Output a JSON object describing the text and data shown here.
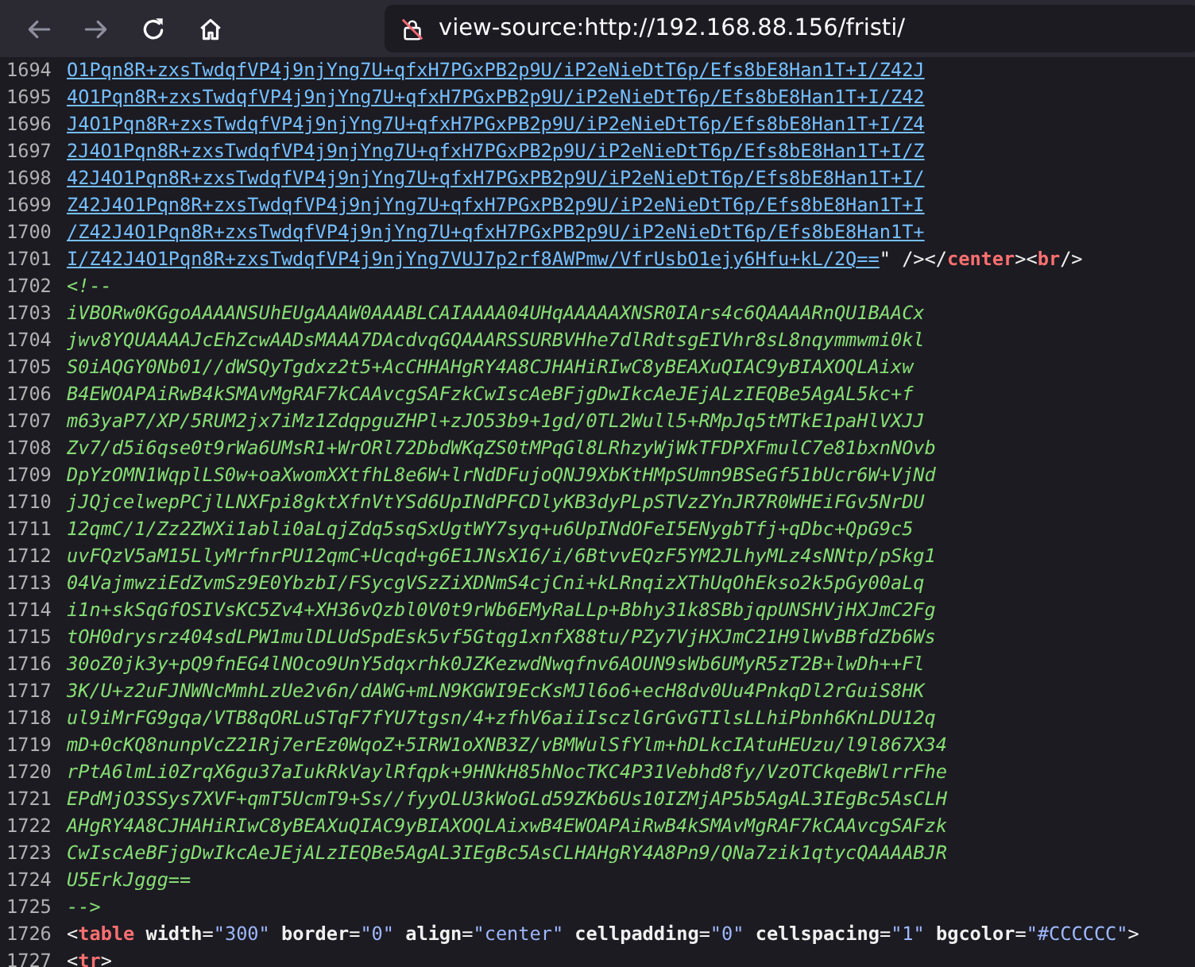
{
  "toolbar": {
    "nav": [
      {
        "kind": "back",
        "disabled": true
      },
      {
        "kind": "forward",
        "disabled": true
      },
      {
        "kind": "reload",
        "disabled": false
      },
      {
        "kind": "home",
        "disabled": false
      }
    ],
    "url": "view-source:http://192.168.88.156/fristi/"
  },
  "lines": [
    {
      "number": "1694",
      "tokens": [
        {
          "kind": "link",
          "text": "O1Pqn8R+zxsTwdqfVP4j9njYng7U+qfxH7PGxPB2p9U/iP2eNieDtT6p/Efs8bE8Han1T+I/Z42J"
        }
      ]
    },
    {
      "number": "1695",
      "tokens": [
        {
          "kind": "link",
          "text": "4O1Pqn8R+zxsTwdqfVP4j9njYng7U+qfxH7PGxPB2p9U/iP2eNieDtT6p/Efs8bE8Han1T+I/Z42"
        }
      ]
    },
    {
      "number": "1696",
      "tokens": [
        {
          "kind": "link",
          "text": "J4O1Pqn8R+zxsTwdqfVP4j9njYng7U+qfxH7PGxPB2p9U/iP2eNieDtT6p/Efs8bE8Han1T+I/Z4"
        }
      ]
    },
    {
      "number": "1697",
      "tokens": [
        {
          "kind": "link",
          "text": "2J4O1Pqn8R+zxsTwdqfVP4j9njYng7U+qfxH7PGxPB2p9U/iP2eNieDtT6p/Efs8bE8Han1T+I/Z"
        }
      ]
    },
    {
      "number": "1698",
      "tokens": [
        {
          "kind": "link",
          "text": "42J4O1Pqn8R+zxsTwdqfVP4j9njYng7U+qfxH7PGxPB2p9U/iP2eNieDtT6p/Efs8bE8Han1T+I/"
        }
      ]
    },
    {
      "number": "1699",
      "tokens": [
        {
          "kind": "link",
          "text": "Z42J4O1Pqn8R+zxsTwdqfVP4j9njYng7U+qfxH7PGxPB2p9U/iP2eNieDtT6p/Efs8bE8Han1T+I"
        }
      ]
    },
    {
      "number": "1700",
      "tokens": [
        {
          "kind": "link",
          "text": "/Z42J4O1Pqn8R+zxsTwdqfVP4j9njYng7U+qfxH7PGxPB2p9U/iP2eNieDtT6p/Efs8bE8Han1T+"
        }
      ]
    },
    {
      "number": "1701",
      "tokens": [
        {
          "kind": "link",
          "text": "I/Z42J4O1Pqn8R+zxsTwdqfVP4j9njYng7VUJ7p2rf8AWPmw/VfrUsbO1ejy6Hfu+kL/2Q=="
        },
        {
          "kind": "punct",
          "text": "\" /></"
        },
        {
          "kind": "tag",
          "text": "center"
        },
        {
          "kind": "punct",
          "text": "><"
        },
        {
          "kind": "tag",
          "text": "br"
        },
        {
          "kind": "punct",
          "text": "/>"
        }
      ]
    },
    {
      "number": "1702",
      "tokens": [
        {
          "kind": "comment",
          "text": "<!--"
        }
      ]
    },
    {
      "number": "1703",
      "tokens": [
        {
          "kind": "comment",
          "text": "iVBORw0KGgoAAAANSUhEUgAAAW0AAABLCAIAAAA04UHqAAAAAXNSR0IArs4c6QAAAARnQU1BAACx"
        }
      ]
    },
    {
      "number": "1704",
      "tokens": [
        {
          "kind": "comment",
          "text": "jwv8YQUAAAAJcEhZcwAADsMAAA7DAcdvqGQAAARSSURBVHhe7dlRdtsgEIVhr8sL8nqymmwmi0kl"
        }
      ]
    },
    {
      "number": "1705",
      "tokens": [
        {
          "kind": "comment",
          "text": "S0iAQGY0Nb01//dWSQyTgdxz2t5+AcCHHAHgRY4A8CJHAHiRIwC8yBEAXuQIAC9yBIAXOQLAixw"
        }
      ]
    },
    {
      "number": "1706",
      "tokens": [
        {
          "kind": "comment",
          "text": "B4EWOAPAiRwB4kSMAvMgRAF7kCAAvcgSAFzkCwIscAeBFjgDwIkcAeJEjALzIEQBe5AgAL5kc+f"
        }
      ]
    },
    {
      "number": "1707",
      "tokens": [
        {
          "kind": "comment",
          "text": "m63yaP7/XP/5RUM2jx7iMz1ZdqpguZHPl+zJO53b9+1gd/0TL2Wull5+RMpJq5tMTkE1paHlVXJJ"
        }
      ]
    },
    {
      "number": "1708",
      "tokens": [
        {
          "kind": "comment",
          "text": "Zv7/d5i6qse0t9rWa6UMsR1+WrORl72DbdWKqZS0tMPqGl8LRhzyWjWkTFDPXFmulC7e81bxnNOvb"
        }
      ]
    },
    {
      "number": "1709",
      "tokens": [
        {
          "kind": "comment",
          "text": "DpYzOMN1WqplLS0w+oaXwomXXtfhL8e6W+lrNdDFujoQNJ9XbKtHMpSUmn9BSeGf51bUcr6W+VjNd"
        }
      ]
    },
    {
      "number": "1710",
      "tokens": [
        {
          "kind": "comment",
          "text": "jJQjcelwepPCjlLNXFpi8gktXfnVtYSd6UpINdPFCDlyKB3dyPLpSTVzZYnJR7R0WHEiFGv5NrDU"
        }
      ]
    },
    {
      "number": "1711",
      "tokens": [
        {
          "kind": "comment",
          "text": "12qmC/1/Zz2ZWXi1abli0aLqjZdq5sqSxUgtWY7syq+u6UpINdOFeI5ENygbTfj+qDbc+QpG9c5"
        }
      ]
    },
    {
      "number": "1712",
      "tokens": [
        {
          "kind": "comment",
          "text": "uvFQzV5aM15LlyMrfnrPU12qmC+Ucqd+g6E1JNsX16/i/6BtvvEQzF5YM2JLhyMLz4sNNtp/pSkg1"
        }
      ]
    },
    {
      "number": "1713",
      "tokens": [
        {
          "kind": "comment",
          "text": "04VajmwziEdZvmSz9E0YbzbI/FSycgVSzZiXDNmS4cjCni+kLRnqizXThUqOhEkso2k5pGy00aLq"
        }
      ]
    },
    {
      "number": "1714",
      "tokens": [
        {
          "kind": "comment",
          "text": "i1n+skSqGfOSIVsKC5Zv4+XH36vQzbl0V0t9rWb6EMyRaLLp+Bbhy31k8SBbjqpUNSHVjHXJmC2Fg"
        }
      ]
    },
    {
      "number": "1715",
      "tokens": [
        {
          "kind": "comment",
          "text": "tOH0drysrz404sdLPW1mulDLUdSpdEsk5vf5Gtqg1xnfX88tu/PZy7VjHXJmC21H9lWvBBfdZb6Ws"
        }
      ]
    },
    {
      "number": "1716",
      "tokens": [
        {
          "kind": "comment",
          "text": "30oZ0jk3y+pQ9fnEG4lNOco9UnY5dqxrhk0JZKezwdNwqfnv6AOUN9sWb6UMyR5zT2B+lwDh++Fl"
        }
      ]
    },
    {
      "number": "1717",
      "tokens": [
        {
          "kind": "comment",
          "text": "3K/U+z2uFJNWNcMmhLzUe2v6n/dAWG+mLN9KGWI9EcKsMJl6o6+ecH8dv0Uu4PnkqDl2rGuiS8HK"
        }
      ]
    },
    {
      "number": "1718",
      "tokens": [
        {
          "kind": "comment",
          "text": "ul9iMrFG9gqa/VTB8qORLuSTqF7fYU7tgsn/4+zfhV6aiiIsczlGrGvGTIlsLLhiPbnh6KnLDU12q"
        }
      ]
    },
    {
      "number": "1719",
      "tokens": [
        {
          "kind": "comment",
          "text": "mD+0cKQ8nunpVcZ21Rj7erEz0WqoZ+5IRW1oXNB3Z/vBMWulSfYlm+hDLkcIAtuHEUzu/l9l867X34"
        }
      ]
    },
    {
      "number": "1720",
      "tokens": [
        {
          "kind": "comment",
          "text": "rPtA6lmLi0ZrqX6gu37aIukRkVaylRfqpk+9HNkH85hNocTKC4P31Vebhd8fy/VzOTCkqeBWlrrFhe"
        }
      ]
    },
    {
      "number": "1721",
      "tokens": [
        {
          "kind": "comment",
          "text": "EPdMjO3SSys7XVF+qmT5UcmT9+Ss//fyyOLU3kWoGLd59ZKb6Us10IZMjAP5b5AgAL3IEgBc5AsCLH"
        }
      ]
    },
    {
      "number": "1722",
      "tokens": [
        {
          "kind": "comment",
          "text": "AHgRY4A8CJHAHiRIwC8yBEAXuQIAC9yBIAXOQLAixwB4EWOAPAiRwB4kSMAvMgRAF7kCAAvcgSAFzk"
        }
      ]
    },
    {
      "number": "1723",
      "tokens": [
        {
          "kind": "comment",
          "text": "CwIscAeBFjgDwIkcAeJEjALzIEQBe5AgAL3IEgBc5AsCLHAHgRY4A8Pn9/QNa7zik1qtycQAAAABJR"
        }
      ]
    },
    {
      "number": "1724",
      "tokens": [
        {
          "kind": "comment",
          "text": "U5ErkJggg=="
        }
      ]
    },
    {
      "number": "1725",
      "tokens": [
        {
          "kind": "comment",
          "text": "-->"
        }
      ]
    },
    {
      "number": "1726",
      "tokens": [
        {
          "kind": "punct",
          "text": "<"
        },
        {
          "kind": "tag",
          "text": "table"
        },
        {
          "kind": "attr",
          "text": " width"
        },
        {
          "kind": "punct",
          "text": "="
        },
        {
          "kind": "value",
          "text": "\"300\""
        },
        {
          "kind": "attr",
          "text": " border"
        },
        {
          "kind": "punct",
          "text": "="
        },
        {
          "kind": "value",
          "text": "\"0\""
        },
        {
          "kind": "attr",
          "text": " align"
        },
        {
          "kind": "punct",
          "text": "="
        },
        {
          "kind": "value",
          "text": "\"center\""
        },
        {
          "kind": "attr",
          "text": " cellpadding"
        },
        {
          "kind": "punct",
          "text": "="
        },
        {
          "kind": "value",
          "text": "\"0\""
        },
        {
          "kind": "attr",
          "text": " cellspacing"
        },
        {
          "kind": "punct",
          "text": "="
        },
        {
          "kind": "value",
          "text": "\"1\""
        },
        {
          "kind": "attr",
          "text": " bgcolor"
        },
        {
          "kind": "punct",
          "text": "="
        },
        {
          "kind": "value",
          "text": "\"#CCCCCC\""
        },
        {
          "kind": "punct",
          "text": ">"
        }
      ]
    },
    {
      "number": "1727",
      "tokens": [
        {
          "kind": "punct",
          "text": "<"
        },
        {
          "kind": "tag",
          "text": "tr"
        },
        {
          "kind": "punct",
          "text": ">"
        }
      ]
    }
  ]
}
